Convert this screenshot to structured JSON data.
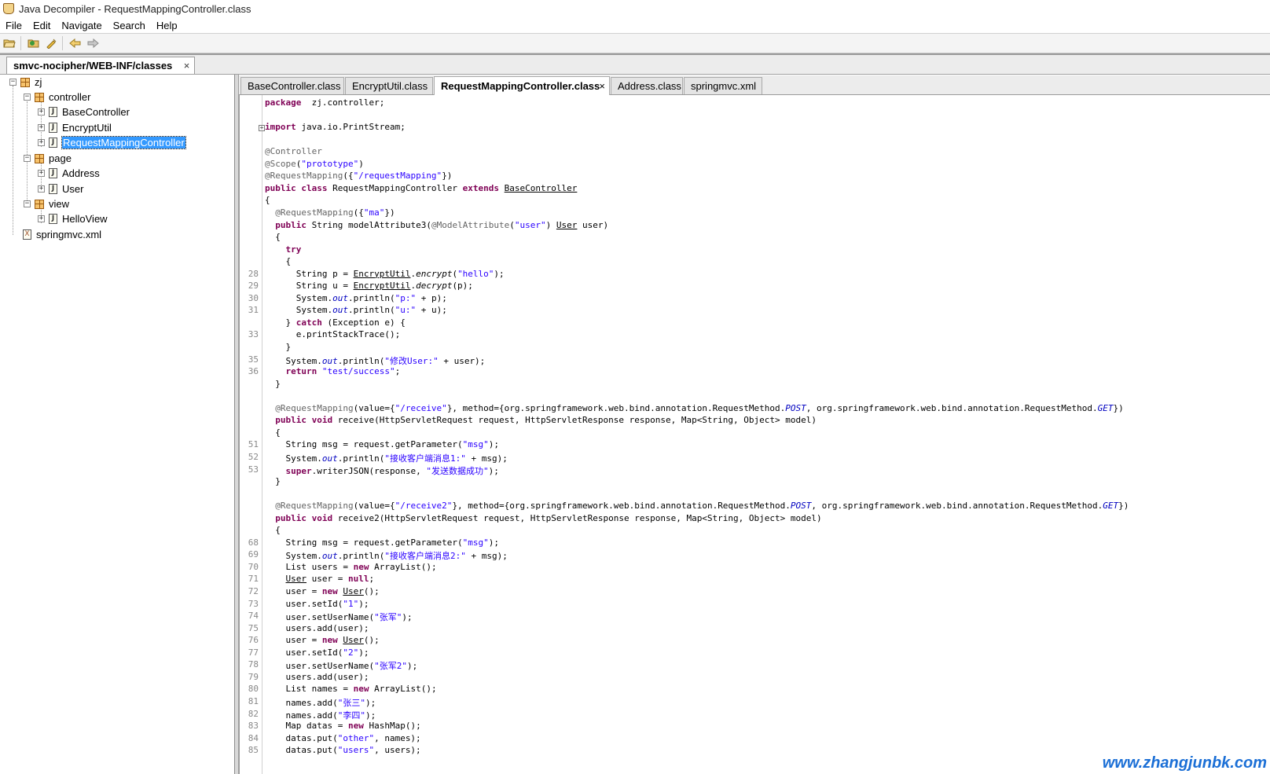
{
  "window": {
    "title": "Java Decompiler - RequestMappingController.class"
  },
  "menu": [
    "File",
    "Edit",
    "Navigate",
    "Search",
    "Help"
  ],
  "outer_tab": {
    "label": "smvc-nocipher/WEB-INF/classes",
    "close": "×"
  },
  "tree": [
    {
      "label": "zj",
      "type": "package",
      "depth": 0,
      "expander": "−"
    },
    {
      "label": "controller",
      "type": "package",
      "depth": 1,
      "expander": "−"
    },
    {
      "label": "BaseController",
      "type": "class",
      "depth": 2,
      "expander": "+"
    },
    {
      "label": "EncryptUtil",
      "type": "class",
      "depth": 2,
      "expander": "+"
    },
    {
      "label": "RequestMappingController",
      "type": "class",
      "depth": 2,
      "expander": "+",
      "selected": true
    },
    {
      "label": "page",
      "type": "package",
      "depth": 1,
      "expander": "−"
    },
    {
      "label": "Address",
      "type": "class",
      "depth": 2,
      "expander": "+"
    },
    {
      "label": "User",
      "type": "class",
      "depth": 2,
      "expander": "+"
    },
    {
      "label": "view",
      "type": "package",
      "depth": 1,
      "expander": "−"
    },
    {
      "label": "HelloView",
      "type": "class",
      "depth": 2,
      "expander": "+"
    },
    {
      "label": "springmvc.xml",
      "type": "xml",
      "depth": 0,
      "expander": ""
    }
  ],
  "editor_tabs": [
    {
      "label": "BaseController.class",
      "active": false
    },
    {
      "label": "EncryptUtil.class",
      "active": false
    },
    {
      "label": "RequestMappingController.class",
      "active": true
    },
    {
      "label": "Address.class",
      "active": false
    },
    {
      "label": "springmvc.xml",
      "active": false
    }
  ],
  "code": [
    {
      "ln": "",
      "segs": [
        [
          "kw",
          "package"
        ],
        [
          "",
          "  zj.controller;"
        ]
      ]
    },
    {
      "ln": "",
      "segs": []
    },
    {
      "ln": "",
      "fold": "+",
      "segs": [
        [
          "kw",
          "import"
        ],
        [
          "",
          " java.io.PrintStream;"
        ]
      ]
    },
    {
      "ln": "",
      "segs": []
    },
    {
      "ln": "",
      "segs": [
        [
          "ann",
          "@Controller"
        ]
      ]
    },
    {
      "ln": "",
      "segs": [
        [
          "ann",
          "@Scope"
        ],
        [
          "",
          "("
        ],
        [
          "str",
          "\"prototype\""
        ],
        [
          "",
          ")"
        ]
      ]
    },
    {
      "ln": "",
      "segs": [
        [
          "ann",
          "@RequestMapping"
        ],
        [
          "",
          "({"
        ],
        [
          "str",
          "\"/requestMapping\""
        ],
        [
          "",
          "})"
        ]
      ]
    },
    {
      "ln": "",
      "segs": [
        [
          "kw",
          "public class"
        ],
        [
          "",
          " RequestMappingController "
        ],
        [
          "kw",
          "extends"
        ],
        [
          "",
          " "
        ],
        [
          "ul",
          "BaseController"
        ]
      ]
    },
    {
      "ln": "",
      "segs": [
        [
          "",
          "{"
        ]
      ]
    },
    {
      "ln": "",
      "segs": [
        [
          "",
          "  "
        ],
        [
          "ann",
          "@RequestMapping"
        ],
        [
          "",
          "({"
        ],
        [
          "str",
          "\"ma\""
        ],
        [
          "",
          "})"
        ]
      ]
    },
    {
      "ln": "",
      "segs": [
        [
          "",
          "  "
        ],
        [
          "kw",
          "public"
        ],
        [
          "",
          " String modelAttribute3("
        ],
        [
          "ann",
          "@ModelAttribute"
        ],
        [
          "",
          "("
        ],
        [
          "str",
          "\"user\""
        ],
        [
          "",
          ") "
        ],
        [
          "ul",
          "User"
        ],
        [
          "",
          " user)"
        ]
      ]
    },
    {
      "ln": "",
      "segs": [
        [
          "",
          "  {"
        ]
      ]
    },
    {
      "ln": "",
      "segs": [
        [
          "",
          "    "
        ],
        [
          "kw",
          "try"
        ]
      ]
    },
    {
      "ln": "",
      "segs": [
        [
          "",
          "    {"
        ]
      ]
    },
    {
      "ln": "28",
      "segs": [
        [
          "",
          "      String p = "
        ],
        [
          "ul",
          "EncryptUtil"
        ],
        [
          "",
          "."
        ],
        [
          "mth",
          "encrypt"
        ],
        [
          "",
          "("
        ],
        [
          "str",
          "\"hello\""
        ],
        [
          "",
          ");"
        ]
      ]
    },
    {
      "ln": "29",
      "segs": [
        [
          "",
          "      String u = "
        ],
        [
          "ul",
          "EncryptUtil"
        ],
        [
          "",
          "."
        ],
        [
          "mth",
          "decrypt"
        ],
        [
          "",
          "(p);"
        ]
      ]
    },
    {
      "ln": "30",
      "segs": [
        [
          "",
          "      System."
        ],
        [
          "fld",
          "out"
        ],
        [
          "",
          ".println("
        ],
        [
          "str",
          "\"p:\""
        ],
        [
          "",
          " + p);"
        ]
      ]
    },
    {
      "ln": "31",
      "segs": [
        [
          "",
          "      System."
        ],
        [
          "fld",
          "out"
        ],
        [
          "",
          ".println("
        ],
        [
          "str",
          "\"u:\""
        ],
        [
          "",
          " + u);"
        ]
      ]
    },
    {
      "ln": "",
      "segs": [
        [
          "",
          "    } "
        ],
        [
          "kw",
          "catch"
        ],
        [
          "",
          " (Exception e) {"
        ]
      ]
    },
    {
      "ln": "33",
      "segs": [
        [
          "",
          "      e.printStackTrace();"
        ]
      ]
    },
    {
      "ln": "",
      "segs": [
        [
          "",
          "    }"
        ]
      ]
    },
    {
      "ln": "35",
      "segs": [
        [
          "",
          "    System."
        ],
        [
          "fld",
          "out"
        ],
        [
          "",
          ".println("
        ],
        [
          "str",
          "\"修改User:\""
        ],
        [
          "",
          " + user);"
        ]
      ]
    },
    {
      "ln": "36",
      "segs": [
        [
          "",
          "    "
        ],
        [
          "kw",
          "return"
        ],
        [
          "",
          " "
        ],
        [
          "str",
          "\"test/success\""
        ],
        [
          "",
          ";"
        ]
      ]
    },
    {
      "ln": "",
      "segs": [
        [
          "",
          "  }"
        ]
      ]
    },
    {
      "ln": "",
      "segs": []
    },
    {
      "ln": "",
      "segs": [
        [
          "",
          "  "
        ],
        [
          "ann",
          "@RequestMapping"
        ],
        [
          "",
          "(value={"
        ],
        [
          "str",
          "\"/receive\""
        ],
        [
          "",
          "}, method={org.springframework.web.bind.annotation.RequestMethod."
        ],
        [
          "fld",
          "POST"
        ],
        [
          "",
          ", org.springframework.web.bind.annotation.RequestMethod."
        ],
        [
          "fld",
          "GET"
        ],
        [
          "",
          "})"
        ]
      ]
    },
    {
      "ln": "",
      "segs": [
        [
          "",
          "  "
        ],
        [
          "kw",
          "public void"
        ],
        [
          "",
          " receive(HttpServletRequest request, HttpServletResponse response, Map<String, Object> model)"
        ]
      ]
    },
    {
      "ln": "",
      "segs": [
        [
          "",
          "  {"
        ]
      ]
    },
    {
      "ln": "51",
      "segs": [
        [
          "",
          "    String msg = request.getParameter("
        ],
        [
          "str",
          "\"msg\""
        ],
        [
          "",
          ");"
        ]
      ]
    },
    {
      "ln": "52",
      "segs": [
        [
          "",
          "    System."
        ],
        [
          "fld",
          "out"
        ],
        [
          "",
          ".println("
        ],
        [
          "str",
          "\"接收客户端消息1:\""
        ],
        [
          "",
          " + msg);"
        ]
      ]
    },
    {
      "ln": "53",
      "segs": [
        [
          "",
          "    "
        ],
        [
          "kw",
          "super"
        ],
        [
          "",
          ".writerJSON(response, "
        ],
        [
          "str",
          "\"发送数据成功\""
        ],
        [
          "",
          ");"
        ]
      ]
    },
    {
      "ln": "",
      "segs": [
        [
          "",
          "  }"
        ]
      ]
    },
    {
      "ln": "",
      "segs": []
    },
    {
      "ln": "",
      "segs": [
        [
          "",
          "  "
        ],
        [
          "ann",
          "@RequestMapping"
        ],
        [
          "",
          "(value={"
        ],
        [
          "str",
          "\"/receive2\""
        ],
        [
          "",
          "}, method={org.springframework.web.bind.annotation.RequestMethod."
        ],
        [
          "fld",
          "POST"
        ],
        [
          "",
          ", org.springframework.web.bind.annotation.RequestMethod."
        ],
        [
          "fld",
          "GET"
        ],
        [
          "",
          "})"
        ]
      ]
    },
    {
      "ln": "",
      "segs": [
        [
          "",
          "  "
        ],
        [
          "kw",
          "public void"
        ],
        [
          "",
          " receive2(HttpServletRequest request, HttpServletResponse response, Map<String, Object> model)"
        ]
      ]
    },
    {
      "ln": "",
      "segs": [
        [
          "",
          "  {"
        ]
      ]
    },
    {
      "ln": "68",
      "segs": [
        [
          "",
          "    String msg = request.getParameter("
        ],
        [
          "str",
          "\"msg\""
        ],
        [
          "",
          ");"
        ]
      ]
    },
    {
      "ln": "69",
      "segs": [
        [
          "",
          "    System."
        ],
        [
          "fld",
          "out"
        ],
        [
          "",
          ".println("
        ],
        [
          "str",
          "\"接收客户端消息2:\""
        ],
        [
          "",
          " + msg);"
        ]
      ]
    },
    {
      "ln": "70",
      "segs": [
        [
          "",
          "    List users = "
        ],
        [
          "kw",
          "new"
        ],
        [
          "",
          " ArrayList();"
        ]
      ]
    },
    {
      "ln": "71",
      "segs": [
        [
          "",
          "    "
        ],
        [
          "ul",
          "User"
        ],
        [
          "",
          " user = "
        ],
        [
          "kw",
          "null"
        ],
        [
          "",
          ";"
        ]
      ]
    },
    {
      "ln": "72",
      "segs": [
        [
          "",
          "    user = "
        ],
        [
          "kw",
          "new"
        ],
        [
          "",
          " "
        ],
        [
          "ul",
          "User"
        ],
        [
          "",
          "();"
        ]
      ]
    },
    {
      "ln": "73",
      "segs": [
        [
          "",
          "    user.setId("
        ],
        [
          "str",
          "\"1\""
        ],
        [
          "",
          ");"
        ]
      ]
    },
    {
      "ln": "74",
      "segs": [
        [
          "",
          "    user.setUserName("
        ],
        [
          "str",
          "\"张军\""
        ],
        [
          "",
          ");"
        ]
      ]
    },
    {
      "ln": "75",
      "segs": [
        [
          "",
          "    users.add(user);"
        ]
      ]
    },
    {
      "ln": "76",
      "segs": [
        [
          "",
          "    user = "
        ],
        [
          "kw",
          "new"
        ],
        [
          "",
          " "
        ],
        [
          "ul",
          "User"
        ],
        [
          "",
          "();"
        ]
      ]
    },
    {
      "ln": "77",
      "segs": [
        [
          "",
          "    user.setId("
        ],
        [
          "str",
          "\"2\""
        ],
        [
          "",
          ");"
        ]
      ]
    },
    {
      "ln": "78",
      "segs": [
        [
          "",
          "    user.setUserName("
        ],
        [
          "str",
          "\"张军2\""
        ],
        [
          "",
          ");"
        ]
      ]
    },
    {
      "ln": "79",
      "segs": [
        [
          "",
          "    users.add(user);"
        ]
      ]
    },
    {
      "ln": "80",
      "segs": [
        [
          "",
          "    List names = "
        ],
        [
          "kw",
          "new"
        ],
        [
          "",
          " ArrayList();"
        ]
      ]
    },
    {
      "ln": "81",
      "segs": [
        [
          "",
          "    names.add("
        ],
        [
          "str",
          "\"张三\""
        ],
        [
          "",
          ");"
        ]
      ]
    },
    {
      "ln": "82",
      "segs": [
        [
          "",
          "    names.add("
        ],
        [
          "str",
          "\"李四\""
        ],
        [
          "",
          ");"
        ]
      ]
    },
    {
      "ln": "83",
      "segs": [
        [
          "",
          "    Map datas = "
        ],
        [
          "kw",
          "new"
        ],
        [
          "",
          " HashMap();"
        ]
      ]
    },
    {
      "ln": "84",
      "segs": [
        [
          "",
          "    datas.put("
        ],
        [
          "str",
          "\"other\""
        ],
        [
          "",
          ", names);"
        ]
      ]
    },
    {
      "ln": "85",
      "segs": [
        [
          "",
          "    datas.put("
        ],
        [
          "str",
          "\"users\""
        ],
        [
          "",
          ", users);"
        ]
      ]
    }
  ],
  "watermark": "www.zhangjunbk.com"
}
